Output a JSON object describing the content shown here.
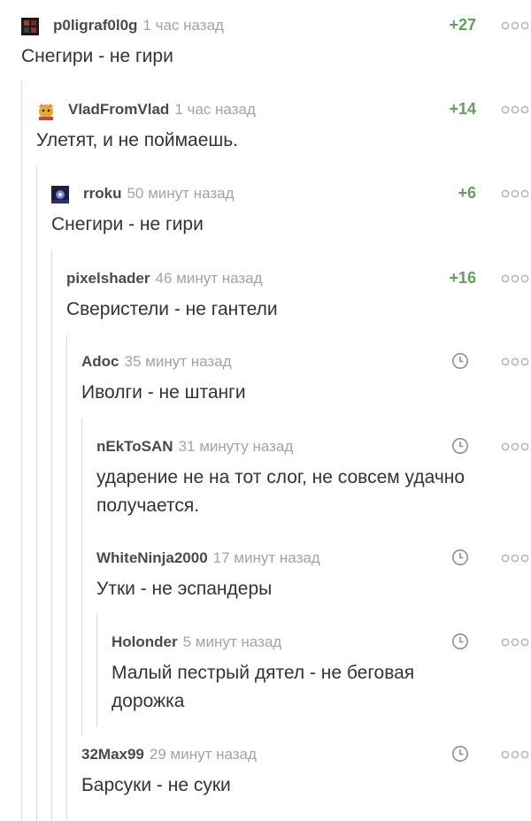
{
  "comments": [
    {
      "user": "p0ligraf0l0g",
      "time": "1 час назад",
      "rating": "+27",
      "text": "Снегири - не гири"
    },
    {
      "user": "VladFromVlad",
      "time": "1 час назад",
      "rating": "+14",
      "text": "Улетят, и не поймаешь."
    },
    {
      "user": "rroku",
      "time": "50 минут назад",
      "rating": "+6",
      "text": "Снегири - не гири"
    },
    {
      "user": "pixelshader",
      "time": "46 минут назад",
      "rating": "+16",
      "text": "Сверистели - не гантели"
    },
    {
      "user": "Adoc",
      "time": "35 минут назад",
      "rating": "",
      "text": "Иволги - не штанги"
    },
    {
      "user": "nEkToSAN",
      "time": "31 минуту назад",
      "rating": "",
      "text": "ударение не на тот слог, не совсем удачно получается."
    },
    {
      "user": "WhiteNinja2000",
      "time": "17 минут назад",
      "rating": "",
      "text": "Утки - не эспандеры"
    },
    {
      "user": "Holonder",
      "time": "5 минут назад",
      "rating": "",
      "text": "Малый пестрый дятел - не беговая дорожка"
    },
    {
      "user": "32Max99",
      "time": "29 минут назад",
      "rating": "",
      "text": "Барсуки - не суки"
    }
  ],
  "icons": {
    "more": "more-dots-icon",
    "clock": "clock-icon"
  },
  "colors": {
    "rating": "#5fa05a",
    "username": "#4a4a4a",
    "time": "#a3a3a3",
    "text": "#333333",
    "thread": "#d9d9d9"
  }
}
